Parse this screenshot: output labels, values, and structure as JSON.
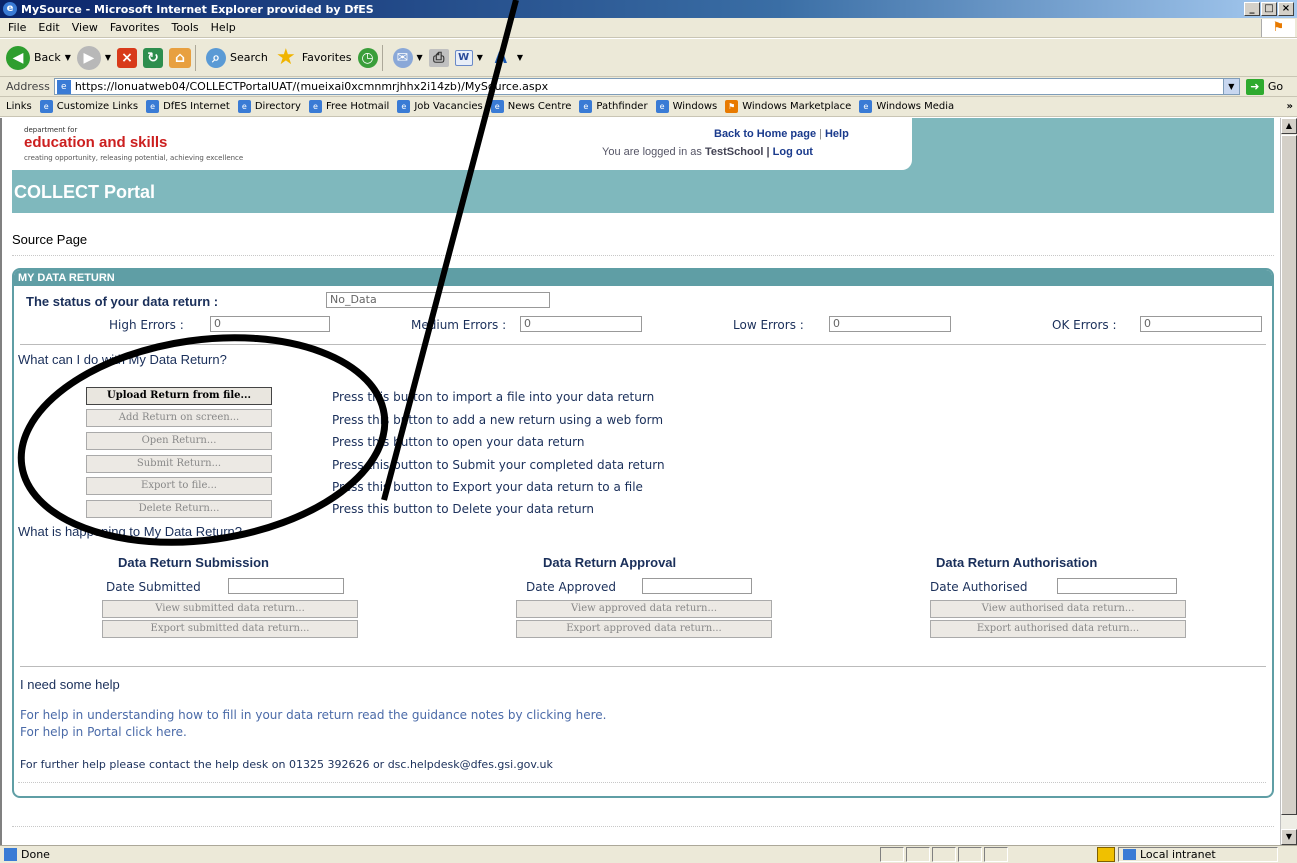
{
  "window": {
    "title": "MySource - Microsoft Internet Explorer provided by DfES",
    "minimize": "_",
    "maximize": "□",
    "close": "×"
  },
  "menu": {
    "items": [
      "File",
      "Edit",
      "View",
      "Favorites",
      "Tools",
      "Help"
    ]
  },
  "toolbar": {
    "back_label": "Back",
    "search_label": "Search",
    "favorites_label": "Favorites"
  },
  "address": {
    "label": "Address",
    "url": "https://lonuatweb04/COLLECTPortalUAT/(mueixai0xcmnmrjhhx2i14zb)/MySource.aspx",
    "go_label": "Go"
  },
  "links": {
    "label": "Links",
    "items": [
      "Customize Links",
      "DfES Internet",
      "Directory",
      "Free Hotmail",
      "Job Vacancies",
      "News Centre",
      "Pathfinder",
      "Windows",
      "Windows Marketplace",
      "Windows Media"
    ],
    "more": "»"
  },
  "header": {
    "org_small": "department for",
    "org_name": "education and skills",
    "org_tagline": "creating opportunity, releasing potential, achieving excellence",
    "home_link": "Back to Home page",
    "help_link": "Help",
    "logged_prefix": "You are logged in as",
    "logged_user": "TestSchool",
    "logout_link": "Log out",
    "portal_title": "COLLECT Portal"
  },
  "page": {
    "title": "Source Page"
  },
  "panel": {
    "heading": "MY DATA RETURN",
    "status_label": "The status of your data return :",
    "status_value": "No_Data",
    "errors": [
      {
        "label": "High Errors :",
        "value": "0"
      },
      {
        "label": "Medium Errors :",
        "value": "0"
      },
      {
        "label": "Low Errors :",
        "value": "0"
      },
      {
        "label": "OK Errors :",
        "value": "0"
      }
    ],
    "actions_title": "What can I do with My Data Return?",
    "actions": [
      {
        "label": "Upload Return from file...",
        "desc": "Press this button to import a file into your data return"
      },
      {
        "label": "Add Return on screen...",
        "desc": "Press this button to add a new return using a web form"
      },
      {
        "label": "Open Return...",
        "desc": "Press this button to open your data return"
      },
      {
        "label": "Submit Return...",
        "desc": "Press this button to Submit your completed data return"
      },
      {
        "label": "Export to file...",
        "desc": "Press this button to Export your data return to a file"
      },
      {
        "label": "Delete Return...",
        "desc": "Press this button to Delete your data return"
      }
    ],
    "happening_title": "What is happening to My Data Return?",
    "columns": [
      {
        "title": "Data Return Submission",
        "date_label": "Date Submitted",
        "view_btn": "View submitted data return...",
        "export_btn": "Export submitted data return..."
      },
      {
        "title": "Data Return Approval",
        "date_label": "Date Approved",
        "view_btn": "View approved data return...",
        "export_btn": "Export approved data return..."
      },
      {
        "title": "Data Return Authorisation",
        "date_label": "Date Authorised",
        "view_btn": "View authorised data return...",
        "export_btn": "Export authorised data return..."
      }
    ],
    "help_title": "I need some help",
    "help_guidance": "For help in understanding how to fill in your data return read the guidance notes by clicking here.",
    "help_portal": "For help in Portal click here.",
    "help_contact": "For further help please contact the help desk on 01325 392626 or dsc.helpdesk@dfes.gsi.gov.uk"
  },
  "status": {
    "text": "Done",
    "zone": "Local intranet"
  }
}
